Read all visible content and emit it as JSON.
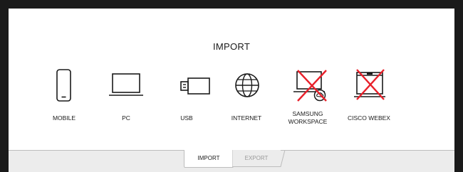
{
  "dialog": {
    "title": "IMPORT"
  },
  "sources": [
    {
      "label": "MOBILE",
      "icon": "mobile-phone-icon",
      "disabled": false
    },
    {
      "label": "PC",
      "icon": "laptop-icon",
      "disabled": false
    },
    {
      "label": "USB",
      "icon": "usb-drive-icon",
      "disabled": false
    },
    {
      "label": "INTERNET",
      "icon": "globe-icon",
      "disabled": false
    },
    {
      "label_lines": [
        "SAMSUNG",
        "WORKSPACE"
      ],
      "icon": "samsung-workspace-icon",
      "disabled": true
    },
    {
      "label": "CISCO WEBEX",
      "icon": "cisco-webex-icon",
      "disabled": true
    }
  ],
  "tabs": {
    "import_label": "IMPORT",
    "export_label": "EXPORT",
    "active": "IMPORT"
  },
  "colors": {
    "disabled_cross": "#e8202a",
    "frame": "#1a1a1a",
    "tab_bar": "#ececec"
  }
}
